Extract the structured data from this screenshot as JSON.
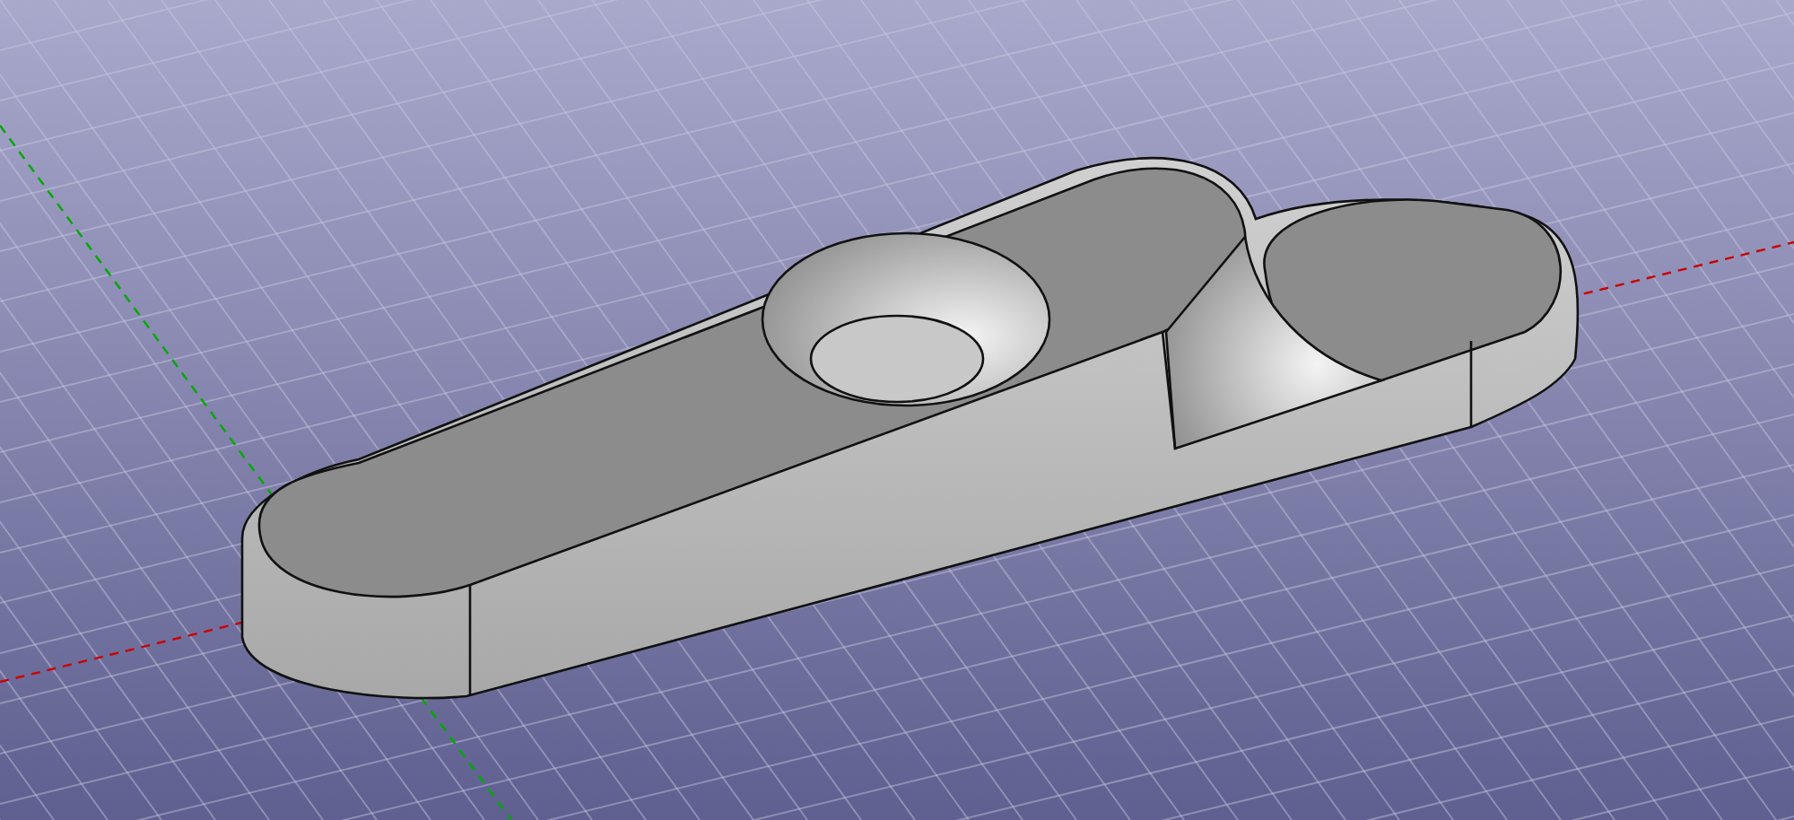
{
  "viewport": {
    "axes": [
      {
        "kind": "x",
        "color": "#cc0000"
      },
      {
        "kind": "y",
        "color": "#00aa00"
      }
    ]
  }
}
